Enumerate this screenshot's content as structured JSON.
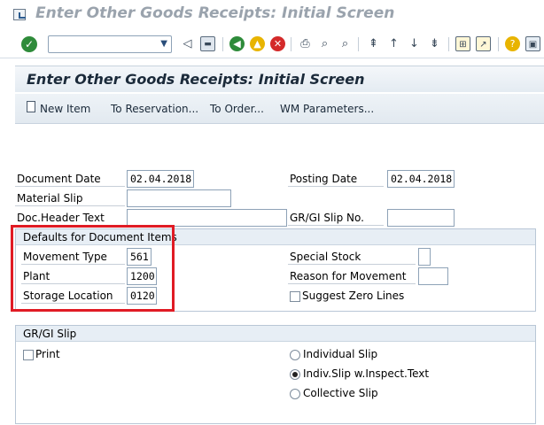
{
  "window": {
    "title": "Enter Other Goods Receipts: Initial Screen"
  },
  "toolbar": {
    "icons": [
      "enter-icon",
      "back-icon",
      "save-icon",
      "green-back-icon",
      "exit-icon",
      "cancel-icon",
      "print-icon",
      "find-icon",
      "find-next-icon",
      "first-page-icon",
      "previous-page-icon",
      "next-page-icon",
      "last-page-icon",
      "layout-icon",
      "help-icon",
      "customize-icon"
    ]
  },
  "screen": {
    "title": "Enter Other Goods Receipts: Initial Screen"
  },
  "app_toolbar": {
    "new_item": "New Item",
    "to_reservation": "To Reservation...",
    "to_order": "To Order...",
    "wm_parameters": "WM Parameters..."
  },
  "header": {
    "document_date_label": "Document Date",
    "document_date": "02.04.2018",
    "posting_date_label": "Posting Date",
    "posting_date": "02.04.2018",
    "material_slip_label": "Material Slip",
    "material_slip": "",
    "doc_header_text_label": "Doc.Header Text",
    "doc_header_text": "",
    "grgi_slip_no_label": "GR/GI Slip No.",
    "grgi_slip_no": ""
  },
  "defaults": {
    "title": "Defaults for Document Items",
    "movement_type_label": "Movement Type",
    "movement_type": "561",
    "plant_label": "Plant",
    "plant": "1200",
    "storage_location_label": "Storage Location",
    "storage_location": "0120",
    "special_stock_label": "Special Stock",
    "special_stock": "",
    "reason_label": "Reason for Movement",
    "reason": "",
    "suggest_zero_lines_label": "Suggest Zero Lines",
    "suggest_zero_lines": false
  },
  "grgi_slip": {
    "title": "GR/GI Slip",
    "print_label": "Print",
    "print": false,
    "individual_slip": "Individual Slip",
    "indiv_inspect": "Indiv.Slip w.Inspect.Text",
    "collective_slip": "Collective Slip",
    "selected": "Indiv.Slip w.Inspect.Text"
  }
}
